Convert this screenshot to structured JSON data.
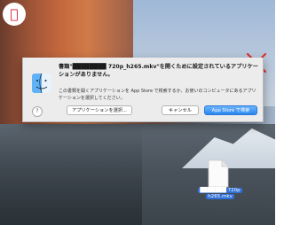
{
  "dialog": {
    "title": "書類\"████████ 720p_h265.mkv\"を開くために設定されているアプリケーションがありません。",
    "body": "この書類を開くアプリケーションを App Store で検索するか、お使いのコンピュータにあるアプリケーションを選択してください。",
    "help_label": "?",
    "buttons": {
      "choose_app": "アプリケーションを選択...",
      "cancel": "キャンセル",
      "app_store": "App Store で検索"
    }
  },
  "desktop": {
    "file_name_line1": "███████ 720p",
    "file_name_line2": "h265.mkv"
  },
  "colors": {
    "dialog_bg": "#ececec",
    "accent_blue": "#2a87f0",
    "red_x": "#e0302a",
    "badge_apple": "#d0102a"
  },
  "icons": [
    "apple-logo-icon",
    "close-x-icon",
    "finder-icon",
    "document-file-icon",
    "help-icon"
  ]
}
